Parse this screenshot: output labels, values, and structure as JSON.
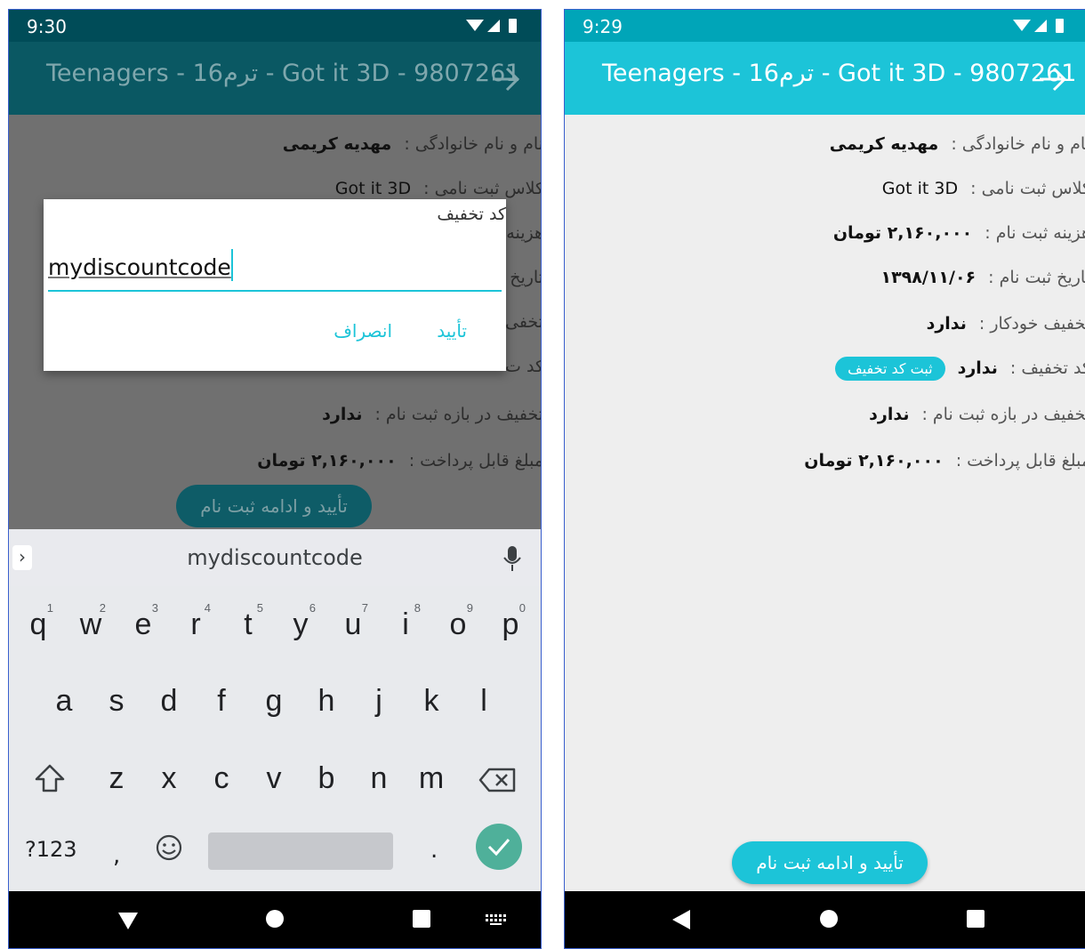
{
  "left": {
    "status_time": "9:30",
    "title": "Teenagers - 16ترم - Got it 3D - 9807261",
    "rows": [
      {
        "label": "نام و نام خانوادگی :",
        "value": "مهدیه کریمی"
      },
      {
        "label": "کلاس ثبت نامی :",
        "value": "Got it 3D"
      },
      {
        "label": "هزینه",
        "value": ""
      },
      {
        "label": "تاریخ",
        "value": ""
      },
      {
        "label": "تخفی",
        "value": ""
      },
      {
        "label": "کد ت",
        "value": ""
      },
      {
        "label": "تخفیف در بازه ثبت نام :",
        "value": "ندارد"
      },
      {
        "label": "مبلغ قابل پرداخت :",
        "value": "۲,۱۶۰,۰۰۰ تومان"
      }
    ],
    "confirm_button": "تأیید و ادامه ثبت نام",
    "dialog": {
      "title": "کد تخفیف",
      "input_value": "mydiscountcode",
      "ok": "تأیید",
      "cancel": "انصراف"
    },
    "keyboard": {
      "suggestion": "mydiscountcode",
      "row1": [
        "q",
        "w",
        "e",
        "r",
        "t",
        "y",
        "u",
        "i",
        "o",
        "p"
      ],
      "row1_nums": [
        "1",
        "2",
        "3",
        "4",
        "5",
        "6",
        "7",
        "8",
        "9",
        "0"
      ],
      "row2": [
        "a",
        "s",
        "d",
        "f",
        "g",
        "h",
        "j",
        "k",
        "l"
      ],
      "row3": [
        "z",
        "x",
        "c",
        "v",
        "b",
        "n",
        "m"
      ],
      "symbols": "?123",
      "comma": ",",
      "period": "."
    }
  },
  "right": {
    "status_time": "9:29",
    "title": "Teenagers - 16ترم - Got it 3D - 9807261",
    "rows": [
      {
        "label": "نام و نام خانوادگی :",
        "value": "مهدیه کریمی"
      },
      {
        "label": "کلاس ثبت نامی :",
        "value": "Got it 3D"
      },
      {
        "label": "هزینه ثبت نام :",
        "value": "۲,۱۶۰,۰۰۰ تومان"
      },
      {
        "label": "تاریخ ثبت نام :",
        "value": "۱۳۹۸/۱۱/۰۶"
      },
      {
        "label": "تخفیف خودکار :",
        "value": "ندارد"
      },
      {
        "label": "کد تخفیف :",
        "value": "ندارد"
      },
      {
        "label": "تخفیف در بازه ثبت نام :",
        "value": "ندارد"
      },
      {
        "label": "مبلغ قابل پرداخت :",
        "value": "۲,۱۶۰,۰۰۰ تومان"
      }
    ],
    "discount_pill": "ثبت کد تخفیف",
    "confirm_button": "تأیید و ادامه ثبت نام"
  },
  "colors": {
    "accent": "#1cc4d8",
    "accent_dark": "#00a5b8",
    "enter_key": "#4fb09a"
  },
  "icons": [
    "wifi-icon",
    "signal-icon",
    "battery-icon",
    "back-arrow-icon",
    "mic-icon",
    "shift-icon",
    "backspace-icon",
    "emoji-icon",
    "check-icon",
    "nav-back-icon",
    "nav-home-icon",
    "nav-recents-icon",
    "keyboard-switch-icon"
  ]
}
